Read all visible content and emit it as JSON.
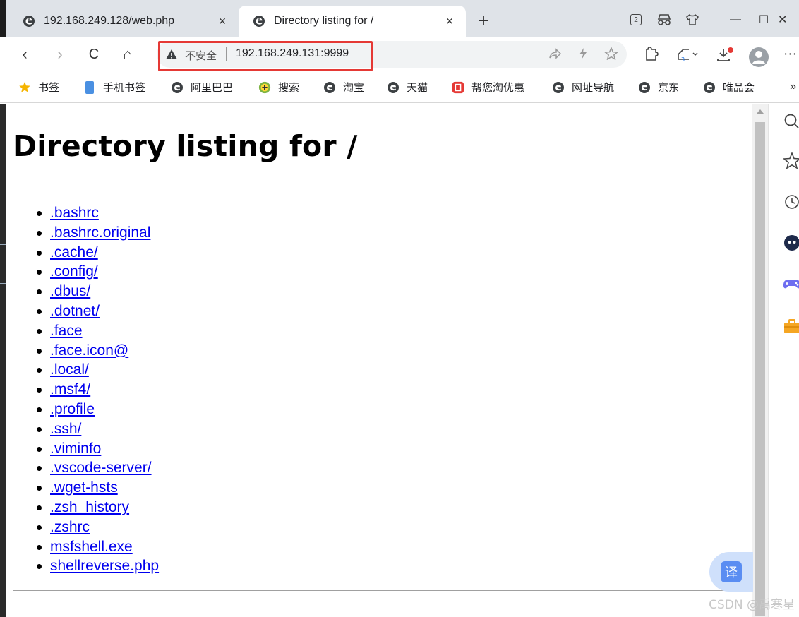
{
  "tabs": [
    {
      "title": "192.168.249.128/web.php",
      "close": "×"
    },
    {
      "title": "Directory listing for /",
      "close": "×"
    }
  ],
  "new_tab": "+",
  "window_controls": {
    "badge": "2",
    "minimize": "—",
    "maximize": "☐",
    "close": "✕"
  },
  "toolbar": {
    "back": "‹",
    "forward": "›",
    "reload": "C",
    "home": "⌂",
    "security_label": "不安全",
    "url": "192.168.249.131:9999",
    "more": "···"
  },
  "bookmarks": [
    "书签",
    "手机书签",
    "阿里巴巴",
    "搜索",
    "淘宝",
    "天猫",
    "帮您淘优惠",
    "网址导航",
    "京东",
    "唯品会"
  ],
  "bookmarks_more": "»",
  "page": {
    "heading": "Directory listing for /",
    "files": [
      ".bashrc",
      ".bashrc.original",
      ".cache/",
      ".config/",
      ".dbus/",
      ".dotnet/",
      ".face",
      ".face.icon@",
      ".local/",
      ".msf4/",
      ".profile",
      ".ssh/",
      ".viminfo",
      ".vscode-server/",
      ".wget-hsts",
      ".zsh_history",
      ".zshrc",
      "msfshell.exe",
      "shellreverse.php"
    ]
  },
  "translate_label": "译",
  "watermark": "CSDN @禹寒星",
  "colors": {
    "link": "#0000ee",
    "highlight_box": "#e53935",
    "accent": "#5a8df2"
  }
}
